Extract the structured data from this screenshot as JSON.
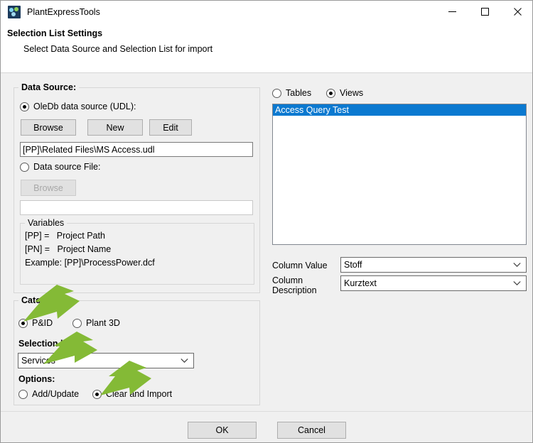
{
  "window": {
    "title": "PlantExpressTools",
    "icon": "app-icon",
    "minimize_label": "─",
    "maximize_label": "□",
    "close_label": "✕"
  },
  "header": {
    "title": "Selection List Settings",
    "subtitle": "Select Data Source and Selection List for import"
  },
  "data_source": {
    "group_title": "Data Source:",
    "oledb_radio_label": "OleDb data source (UDL):",
    "oledb_selected": true,
    "browse_button": "Browse",
    "new_button": "New",
    "edit_button": "Edit",
    "udl_path_value": "[PP]\\Related Files\\MS Access.udl",
    "file_radio_label": "Data source File:",
    "file_selected": false,
    "file_browse_button": "Browse",
    "file_path_value": "",
    "variables": {
      "group_title": "Variables",
      "lines": [
        "[PP] =   Project Path",
        "[PN] =   Project Name",
        "Example: [PP]\\ProcessPower.dcf"
      ]
    }
  },
  "category": {
    "group_title": "Category:",
    "options": [
      {
        "label": "P&ID",
        "selected": true
      },
      {
        "label": "Plant 3D",
        "selected": false
      }
    ],
    "selection_list_label": "Selection list:",
    "selection_list_value": "Services",
    "options_label": "Options:",
    "import_modes": [
      {
        "label": "Add/Update",
        "selected": false
      },
      {
        "label": "Clear and Import",
        "selected": true
      }
    ]
  },
  "right_panel": {
    "source_type": [
      {
        "label": "Tables",
        "selected": false
      },
      {
        "label": "Views",
        "selected": true
      }
    ],
    "list_items": [
      {
        "label": "Access Query Test",
        "selected": true
      }
    ],
    "column_value_label": "Column Value",
    "column_value": "Stoff",
    "column_description_label_line1": "Column",
    "column_description_label_line2": "Description",
    "column_description": "Kurztext"
  },
  "footer": {
    "ok_button": "OK",
    "cancel_button": "Cancel"
  },
  "annotations": {
    "arrow_color": "#84ba36",
    "arrows": [
      {
        "name": "arrow-to-pid-radio",
        "target": "P&ID radio button"
      },
      {
        "name": "arrow-to-selection-list",
        "target": "Selection list combo box"
      },
      {
        "name": "arrow-to-clear-and-import",
        "target": "Clear and Import radio button"
      }
    ]
  }
}
